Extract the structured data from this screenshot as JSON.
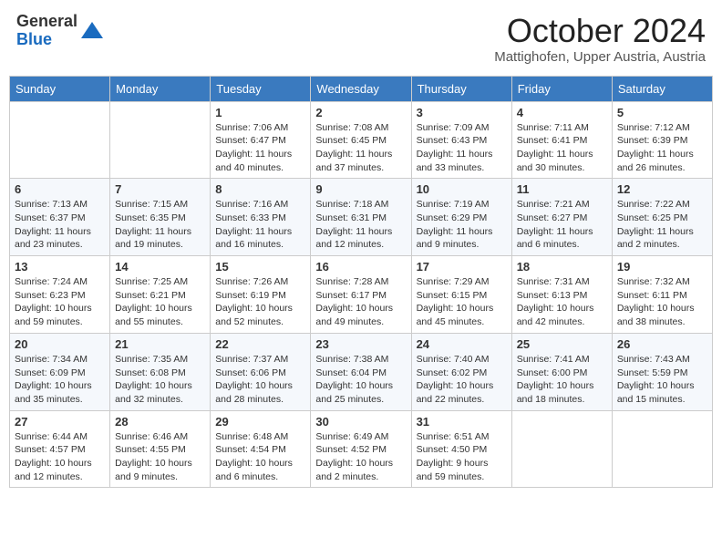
{
  "header": {
    "logo_general": "General",
    "logo_blue": "Blue",
    "month_title": "October 2024",
    "location": "Mattighofen, Upper Austria, Austria"
  },
  "days_of_week": [
    "Sunday",
    "Monday",
    "Tuesday",
    "Wednesday",
    "Thursday",
    "Friday",
    "Saturday"
  ],
  "weeks": [
    [
      {
        "day": "",
        "info": ""
      },
      {
        "day": "",
        "info": ""
      },
      {
        "day": "1",
        "info": "Sunrise: 7:06 AM\nSunset: 6:47 PM\nDaylight: 11 hours and 40 minutes."
      },
      {
        "day": "2",
        "info": "Sunrise: 7:08 AM\nSunset: 6:45 PM\nDaylight: 11 hours and 37 minutes."
      },
      {
        "day": "3",
        "info": "Sunrise: 7:09 AM\nSunset: 6:43 PM\nDaylight: 11 hours and 33 minutes."
      },
      {
        "day": "4",
        "info": "Sunrise: 7:11 AM\nSunset: 6:41 PM\nDaylight: 11 hours and 30 minutes."
      },
      {
        "day": "5",
        "info": "Sunrise: 7:12 AM\nSunset: 6:39 PM\nDaylight: 11 hours and 26 minutes."
      }
    ],
    [
      {
        "day": "6",
        "info": "Sunrise: 7:13 AM\nSunset: 6:37 PM\nDaylight: 11 hours and 23 minutes."
      },
      {
        "day": "7",
        "info": "Sunrise: 7:15 AM\nSunset: 6:35 PM\nDaylight: 11 hours and 19 minutes."
      },
      {
        "day": "8",
        "info": "Sunrise: 7:16 AM\nSunset: 6:33 PM\nDaylight: 11 hours and 16 minutes."
      },
      {
        "day": "9",
        "info": "Sunrise: 7:18 AM\nSunset: 6:31 PM\nDaylight: 11 hours and 12 minutes."
      },
      {
        "day": "10",
        "info": "Sunrise: 7:19 AM\nSunset: 6:29 PM\nDaylight: 11 hours and 9 minutes."
      },
      {
        "day": "11",
        "info": "Sunrise: 7:21 AM\nSunset: 6:27 PM\nDaylight: 11 hours and 6 minutes."
      },
      {
        "day": "12",
        "info": "Sunrise: 7:22 AM\nSunset: 6:25 PM\nDaylight: 11 hours and 2 minutes."
      }
    ],
    [
      {
        "day": "13",
        "info": "Sunrise: 7:24 AM\nSunset: 6:23 PM\nDaylight: 10 hours and 59 minutes."
      },
      {
        "day": "14",
        "info": "Sunrise: 7:25 AM\nSunset: 6:21 PM\nDaylight: 10 hours and 55 minutes."
      },
      {
        "day": "15",
        "info": "Sunrise: 7:26 AM\nSunset: 6:19 PM\nDaylight: 10 hours and 52 minutes."
      },
      {
        "day": "16",
        "info": "Sunrise: 7:28 AM\nSunset: 6:17 PM\nDaylight: 10 hours and 49 minutes."
      },
      {
        "day": "17",
        "info": "Sunrise: 7:29 AM\nSunset: 6:15 PM\nDaylight: 10 hours and 45 minutes."
      },
      {
        "day": "18",
        "info": "Sunrise: 7:31 AM\nSunset: 6:13 PM\nDaylight: 10 hours and 42 minutes."
      },
      {
        "day": "19",
        "info": "Sunrise: 7:32 AM\nSunset: 6:11 PM\nDaylight: 10 hours and 38 minutes."
      }
    ],
    [
      {
        "day": "20",
        "info": "Sunrise: 7:34 AM\nSunset: 6:09 PM\nDaylight: 10 hours and 35 minutes."
      },
      {
        "day": "21",
        "info": "Sunrise: 7:35 AM\nSunset: 6:08 PM\nDaylight: 10 hours and 32 minutes."
      },
      {
        "day": "22",
        "info": "Sunrise: 7:37 AM\nSunset: 6:06 PM\nDaylight: 10 hours and 28 minutes."
      },
      {
        "day": "23",
        "info": "Sunrise: 7:38 AM\nSunset: 6:04 PM\nDaylight: 10 hours and 25 minutes."
      },
      {
        "day": "24",
        "info": "Sunrise: 7:40 AM\nSunset: 6:02 PM\nDaylight: 10 hours and 22 minutes."
      },
      {
        "day": "25",
        "info": "Sunrise: 7:41 AM\nSunset: 6:00 PM\nDaylight: 10 hours and 18 minutes."
      },
      {
        "day": "26",
        "info": "Sunrise: 7:43 AM\nSunset: 5:59 PM\nDaylight: 10 hours and 15 minutes."
      }
    ],
    [
      {
        "day": "27",
        "info": "Sunrise: 6:44 AM\nSunset: 4:57 PM\nDaylight: 10 hours and 12 minutes."
      },
      {
        "day": "28",
        "info": "Sunrise: 6:46 AM\nSunset: 4:55 PM\nDaylight: 10 hours and 9 minutes."
      },
      {
        "day": "29",
        "info": "Sunrise: 6:48 AM\nSunset: 4:54 PM\nDaylight: 10 hours and 6 minutes."
      },
      {
        "day": "30",
        "info": "Sunrise: 6:49 AM\nSunset: 4:52 PM\nDaylight: 10 hours and 2 minutes."
      },
      {
        "day": "31",
        "info": "Sunrise: 6:51 AM\nSunset: 4:50 PM\nDaylight: 9 hours and 59 minutes."
      },
      {
        "day": "",
        "info": ""
      },
      {
        "day": "",
        "info": ""
      }
    ]
  ]
}
